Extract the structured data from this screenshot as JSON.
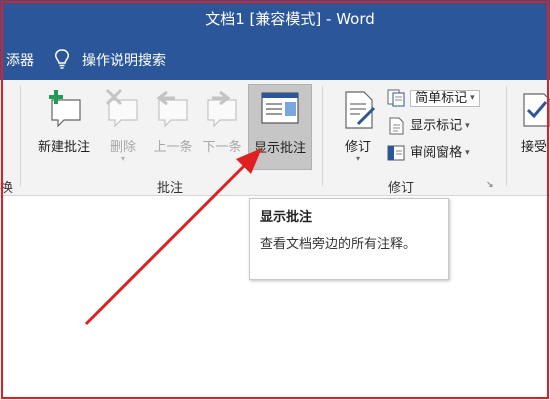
{
  "title": "文档1 [兼容模式] - Word",
  "menubar": {
    "partial_tab": "添器",
    "search_label": "操作说明搜索"
  },
  "ribbon": {
    "comments_group": {
      "label": "批注",
      "buttons": {
        "new": "新建批注",
        "delete": "删除",
        "previous": "上一条",
        "next": "下一条",
        "show": "显示批注"
      }
    },
    "tracking_group": {
      "label": "修订",
      "track_changes": "修订",
      "markup_combo": "简单标记",
      "show_markup": "显示标记",
      "reviewing_pane": "审阅窗格"
    },
    "left_partial_label": "换",
    "accept_partial": "接受"
  },
  "tooltip": {
    "title": "显示批注",
    "body": "查看文档旁边的所有注释。"
  },
  "colors": {
    "titlebar": "#2b579a",
    "annotation": "#e02020",
    "active_button": "#c6c6c6"
  },
  "icons": [
    "lightbulb-icon",
    "new-comment-icon",
    "delete-comment-icon",
    "previous-comment-icon",
    "next-comment-icon",
    "show-comments-icon",
    "track-changes-icon",
    "markup-icon",
    "show-markup-icon",
    "reviewing-pane-icon",
    "accept-icon",
    "dialog-launcher-icon"
  ]
}
